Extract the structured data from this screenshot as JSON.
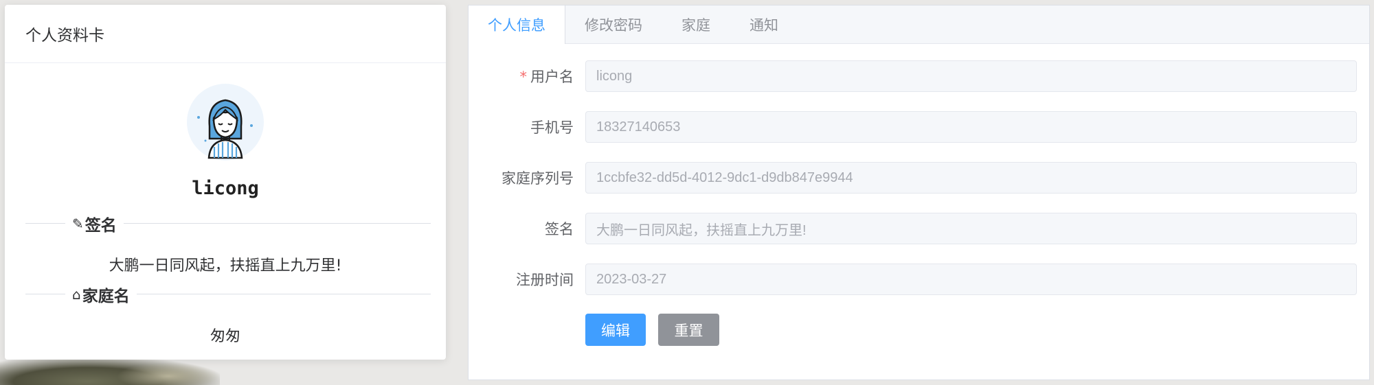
{
  "profile_card": {
    "title": "个人资料卡",
    "username": "licong",
    "signature_heading": "签名",
    "signature_icon": "✎",
    "signature_text": "大鹏一日同风起，扶摇直上九万里!",
    "family_heading": "家庭名",
    "family_icon": "⌂",
    "family_name": "匆匆"
  },
  "tabs": [
    {
      "label": "个人信息",
      "active": true
    },
    {
      "label": "修改密码",
      "active": false
    },
    {
      "label": "家庭",
      "active": false
    },
    {
      "label": "通知",
      "active": false
    }
  ],
  "form": {
    "username_label": "用户名",
    "username_value": "licong",
    "phone_label": "手机号",
    "phone_value": "18327140653",
    "family_serial_label": "家庭序列号",
    "family_serial_value": "1ccbfe32-dd5d-4012-9dc1-d9db847e9944",
    "signature_label": "签名",
    "signature_value": "大鹏一日同风起，扶摇直上九万里!",
    "register_time_label": "注册时间",
    "register_time_value": "2023-03-27",
    "edit_button": "编辑",
    "reset_button": "重置"
  },
  "colors": {
    "accent": "#409eff",
    "required": "#f56c6c",
    "reset": "#909399"
  }
}
